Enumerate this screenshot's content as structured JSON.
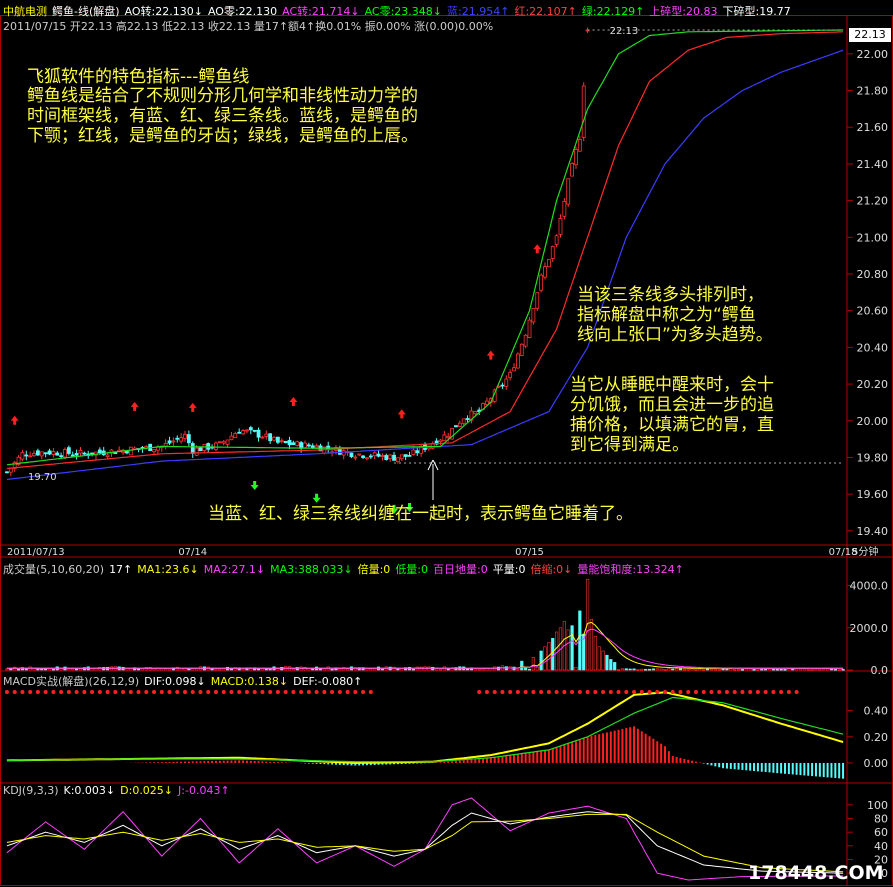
{
  "header": {
    "stock_name": "中航电测",
    "indicator_name": "鳄鱼-线(解盘)",
    "items": [
      {
        "text": "AO转:22.130↓",
        "color": "#ffffff"
      },
      {
        "text": "AO零:22.130",
        "color": "#ffffff"
      },
      {
        "text": "AC转:21.714↓",
        "color": "#ff40ff"
      },
      {
        "text": "AC零:23.348↓",
        "color": "#00ff00"
      },
      {
        "text": "蓝:21.954↑",
        "color": "#4040ff"
      },
      {
        "text": "红:22.107↑",
        "color": "#ff4040"
      },
      {
        "text": "绿:22.129↑",
        "color": "#00ff00"
      },
      {
        "text": "上碎型:20.83",
        "color": "#ff40ff"
      },
      {
        "text": "下碎型:19.77",
        "color": "#ffffff"
      }
    ],
    "info_line": "2011/07/15 开22.13 高22.13 低22.13 收22.13 量17↑额4↑换0.01% 振0.00% 涨(0.00)0.00%",
    "price_tag": "22.13",
    "top_price_label": "22.13",
    "low_label": "19.70"
  },
  "notes": {
    "intro_title": "飞狐软件的特色指标---鳄鱼线",
    "intro_lines": [
      "鳄鱼线是结合了不规则分形几何学和非线性动力学的",
      "时间框架线，有蓝、红、绿三条线。蓝线，是鳄鱼的",
      "下颚；红线，是鳄鱼的牙齿；绿线，是鳄鱼的上唇。"
    ],
    "bull_lines": [
      "当该三条线多头排列时，",
      "指标解盘中称之为“鳄鱼",
      "线向上张口”为多头趋势。"
    ],
    "wake_lines": [
      "当它从睡眠中醒来时，会十",
      "分饥饿，而且会进一步的追",
      "捕价格，以填满它的胃，直",
      "到它得到满足。"
    ],
    "sleep_line": "当蓝、红、绿三条线纠缠在一起时，表示鳄鱼它睡着了。"
  },
  "volume_header": [
    {
      "text": "成交量(5,10,60,20)",
      "color": "#cccccc"
    },
    {
      "text": "17↑",
      "color": "#ffffff"
    },
    {
      "text": "MA1:23.6↓",
      "color": "#ffff00"
    },
    {
      "text": "MA2:27.1↓",
      "color": "#ff40ff"
    },
    {
      "text": "MA3:388.033↓",
      "color": "#00ff00"
    },
    {
      "text": "倍量:0",
      "color": "#ffff00"
    },
    {
      "text": "低量:0",
      "color": "#00ff00"
    },
    {
      "text": "百日地量:0",
      "color": "#ff40ff"
    },
    {
      "text": "平量:0",
      "color": "#ffffff"
    },
    {
      "text": "倍缩:0↓",
      "color": "#ff4040"
    },
    {
      "text": "量能饱和度:13.324↑",
      "color": "#ff40ff"
    }
  ],
  "macd_header": [
    {
      "text": "MACD实战(解盘)(26,12,9)",
      "color": "#cccccc"
    },
    {
      "text": "DIF:0.098↓",
      "color": "#ffffff"
    },
    {
      "text": "MACD:0.138↓",
      "color": "#ffff00"
    },
    {
      "text": "DEF:-0.080↑",
      "color": "#ffffff"
    }
  ],
  "kdj_header": [
    {
      "text": "KDJ(9,3,3)",
      "color": "#cccccc"
    },
    {
      "text": "K:0.003↓",
      "color": "#ffffff"
    },
    {
      "text": "D:0.025↓",
      "color": "#ffff00"
    },
    {
      "text": "J:-0.043↑",
      "color": "#ff40ff"
    }
  ],
  "watermark": "178448.COM",
  "colors": {
    "up": "#ff3232",
    "down": "#54fcfc",
    "blue_line": "#3c3cff",
    "red_line": "#ff2a2a",
    "green_line": "#22dd22",
    "axis": "#b00000"
  },
  "chart_data": [
    {
      "type": "candlestick",
      "panel": "price",
      "period_label": "5分钟",
      "x_date_labels": [
        {
          "label": "2011/07/13",
          "index": 0
        },
        {
          "label": "07/14",
          "index": 48
        },
        {
          "label": "07/15",
          "index": 135
        },
        {
          "label": "07/18",
          "index": 216
        }
      ],
      "y_ticks": [
        19.4,
        19.6,
        19.8,
        20.0,
        20.2,
        20.4,
        20.6,
        20.8,
        21.0,
        21.2,
        21.4,
        21.6,
        21.8,
        22.0
      ],
      "ylim": [
        19.35,
        22.13
      ],
      "n_bars": 217,
      "candle_end_index": 150,
      "anchors": {
        "close": [
          [
            0,
            19.72
          ],
          [
            4,
            19.82
          ],
          [
            10,
            19.83
          ],
          [
            20,
            19.82
          ],
          [
            30,
            19.84
          ],
          [
            40,
            19.86
          ],
          [
            46,
            19.92
          ],
          [
            48,
            19.84
          ],
          [
            55,
            19.87
          ],
          [
            60,
            19.95
          ],
          [
            66,
            19.92
          ],
          [
            70,
            19.88
          ],
          [
            80,
            19.86
          ],
          [
            90,
            19.82
          ],
          [
            100,
            19.8
          ],
          [
            104,
            19.81
          ],
          [
            110,
            19.88
          ],
          [
            114,
            19.93
          ],
          [
            118,
            20.02
          ],
          [
            122,
            20.05
          ],
          [
            126,
            20.15
          ],
          [
            130,
            20.25
          ],
          [
            134,
            20.48
          ],
          [
            138,
            20.78
          ],
          [
            142,
            21.0
          ],
          [
            145,
            21.3
          ],
          [
            148,
            21.55
          ],
          [
            150,
            22.13
          ]
        ],
        "blue": [
          [
            0,
            19.68
          ],
          [
            40,
            19.78
          ],
          [
            80,
            19.82
          ],
          [
            120,
            19.87
          ],
          [
            140,
            20.05
          ],
          [
            150,
            20.4
          ],
          [
            160,
            21.0
          ],
          [
            170,
            21.4
          ],
          [
            180,
            21.65
          ],
          [
            190,
            21.8
          ],
          [
            200,
            21.9
          ],
          [
            216,
            22.02
          ]
        ],
        "red": [
          [
            0,
            19.74
          ],
          [
            40,
            19.82
          ],
          [
            80,
            19.84
          ],
          [
            115,
            19.88
          ],
          [
            130,
            20.05
          ],
          [
            142,
            20.5
          ],
          [
            150,
            21.0
          ],
          [
            158,
            21.5
          ],
          [
            166,
            21.85
          ],
          [
            176,
            22.02
          ],
          [
            186,
            22.09
          ],
          [
            200,
            22.11
          ],
          [
            216,
            22.12
          ]
        ],
        "green": [
          [
            0,
            19.76
          ],
          [
            40,
            19.86
          ],
          [
            80,
            19.85
          ],
          [
            112,
            19.86
          ],
          [
            125,
            20.1
          ],
          [
            135,
            20.6
          ],
          [
            142,
            21.2
          ],
          [
            150,
            21.7
          ],
          [
            158,
            22.0
          ],
          [
            166,
            22.1
          ],
          [
            176,
            22.12
          ],
          [
            216,
            22.13
          ]
        ]
      },
      "fractal_up_indices": [
        2,
        33,
        48,
        74,
        102,
        125,
        137
      ],
      "fractal_down_indices": [
        64,
        80,
        100,
        104
      ]
    },
    {
      "type": "bar",
      "panel": "volume",
      "y_ticks": [
        0,
        2000,
        4000
      ],
      "ylim": [
        0,
        4500
      ],
      "spikes": [
        [
          128,
          200
        ],
        [
          133,
          420
        ],
        [
          136,
          600
        ],
        [
          138,
          900
        ],
        [
          139,
          1100
        ],
        [
          140,
          1300
        ],
        [
          141,
          1500
        ],
        [
          142,
          1800
        ],
        [
          143,
          2000
        ],
        [
          144,
          2300
        ],
        [
          145,
          1900
        ],
        [
          146,
          2100
        ],
        [
          148,
          2800
        ],
        [
          149,
          1700
        ],
        [
          150,
          4300
        ],
        [
          151,
          2400
        ],
        [
          152,
          1600
        ],
        [
          153,
          1100
        ],
        [
          154,
          900
        ],
        [
          155,
          700
        ],
        [
          156,
          500
        ],
        [
          157,
          360
        ]
      ]
    },
    {
      "type": "line",
      "panel": "macd",
      "y_ticks": [
        0.0,
        0.2,
        0.4
      ],
      "ylim": [
        -0.13,
        0.58
      ],
      "dif": [
        [
          0,
          0.02
        ],
        [
          30,
          0.03
        ],
        [
          60,
          0.04
        ],
        [
          90,
          0.0
        ],
        [
          110,
          0.01
        ],
        [
          125,
          0.06
        ],
        [
          140,
          0.15
        ],
        [
          150,
          0.3
        ],
        [
          162,
          0.52
        ],
        [
          170,
          0.54
        ],
        [
          185,
          0.44
        ],
        [
          200,
          0.3
        ],
        [
          216,
          0.16
        ]
      ],
      "dea": [
        [
          0,
          0.02
        ],
        [
          30,
          0.03
        ],
        [
          60,
          0.03
        ],
        [
          90,
          0.01
        ],
        [
          110,
          0.01
        ],
        [
          125,
          0.04
        ],
        [
          140,
          0.1
        ],
        [
          150,
          0.2
        ],
        [
          162,
          0.38
        ],
        [
          172,
          0.5
        ],
        [
          185,
          0.46
        ],
        [
          200,
          0.34
        ],
        [
          216,
          0.22
        ]
      ]
    },
    {
      "type": "line",
      "panel": "kdj",
      "y_ticks": [
        0,
        20,
        40,
        60,
        80,
        100
      ],
      "ylim": [
        -10,
        110
      ],
      "k": [
        [
          0,
          40
        ],
        [
          10,
          60
        ],
        [
          20,
          45
        ],
        [
          30,
          70
        ],
        [
          40,
          40
        ],
        [
          50,
          65
        ],
        [
          60,
          35
        ],
        [
          70,
          55
        ],
        [
          80,
          30
        ],
        [
          90,
          40
        ],
        [
          100,
          25
        ],
        [
          108,
          35
        ],
        [
          115,
          70
        ],
        [
          120,
          88
        ],
        [
          130,
          72
        ],
        [
          140,
          82
        ],
        [
          150,
          90
        ],
        [
          160,
          85
        ],
        [
          168,
          40
        ],
        [
          180,
          12
        ],
        [
          195,
          3
        ],
        [
          216,
          0
        ]
      ],
      "d": [
        [
          0,
          45
        ],
        [
          10,
          55
        ],
        [
          20,
          50
        ],
        [
          30,
          60
        ],
        [
          40,
          48
        ],
        [
          50,
          58
        ],
        [
          60,
          45
        ],
        [
          70,
          50
        ],
        [
          80,
          38
        ],
        [
          90,
          40
        ],
        [
          100,
          32
        ],
        [
          108,
          35
        ],
        [
          115,
          55
        ],
        [
          120,
          75
        ],
        [
          130,
          76
        ],
        [
          140,
          80
        ],
        [
          150,
          86
        ],
        [
          160,
          86
        ],
        [
          168,
          60
        ],
        [
          180,
          25
        ],
        [
          195,
          8
        ],
        [
          216,
          2
        ]
      ],
      "j": [
        [
          0,
          30
        ],
        [
          10,
          75
        ],
        [
          20,
          35
        ],
        [
          30,
          90
        ],
        [
          40,
          25
        ],
        [
          50,
          80
        ],
        [
          60,
          15
        ],
        [
          70,
          65
        ],
        [
          80,
          15
        ],
        [
          90,
          40
        ],
        [
          100,
          10
        ],
        [
          108,
          35
        ],
        [
          115,
          100
        ],
        [
          120,
          110
        ],
        [
          130,
          62
        ],
        [
          140,
          88
        ],
        [
          150,
          98
        ],
        [
          160,
          80
        ],
        [
          168,
          0
        ],
        [
          176,
          -10
        ],
        [
          190,
          -5
        ],
        [
          216,
          -4
        ]
      ]
    }
  ]
}
